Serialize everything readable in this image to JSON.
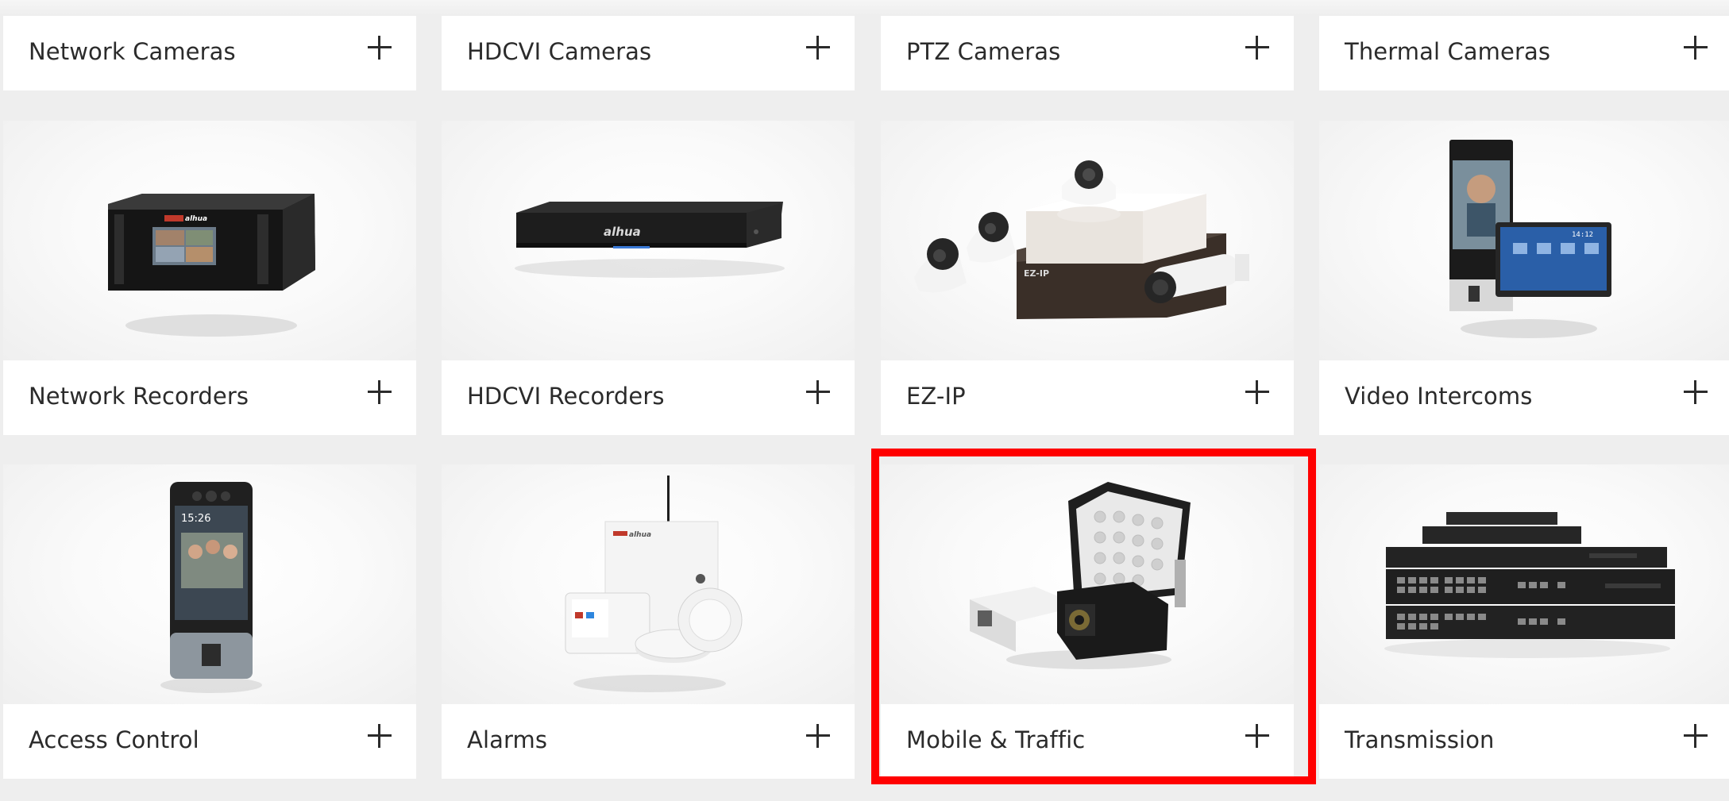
{
  "categories": [
    {
      "label": "Network Cameras",
      "image": "network-camera-image"
    },
    {
      "label": "HDCVI Cameras",
      "image": "hdcvi-camera-image"
    },
    {
      "label": "PTZ Cameras",
      "image": "ptz-camera-image"
    },
    {
      "label": "Thermal Cameras",
      "image": "thermal-camera-image"
    },
    {
      "label": "Network Recorders",
      "image": "network-recorder-image"
    },
    {
      "label": "HDCVI Recorders",
      "image": "hdcvi-recorder-image"
    },
    {
      "label": "EZ-IP",
      "image": "ez-ip-kit-image"
    },
    {
      "label": "Video Intercoms",
      "image": "video-intercom-image"
    },
    {
      "label": "Access Control",
      "image": "access-control-terminal-image"
    },
    {
      "label": "Alarms",
      "image": "alarm-kit-image"
    },
    {
      "label": "Mobile & Traffic",
      "image": "traffic-camera-image"
    },
    {
      "label": "Transmission",
      "image": "network-switch-image"
    }
  ],
  "icons": {
    "expand": "plus-icon"
  },
  "highlight": {
    "target": "Mobile & Traffic",
    "color": "#ff0000"
  },
  "brand_text": "alhua"
}
